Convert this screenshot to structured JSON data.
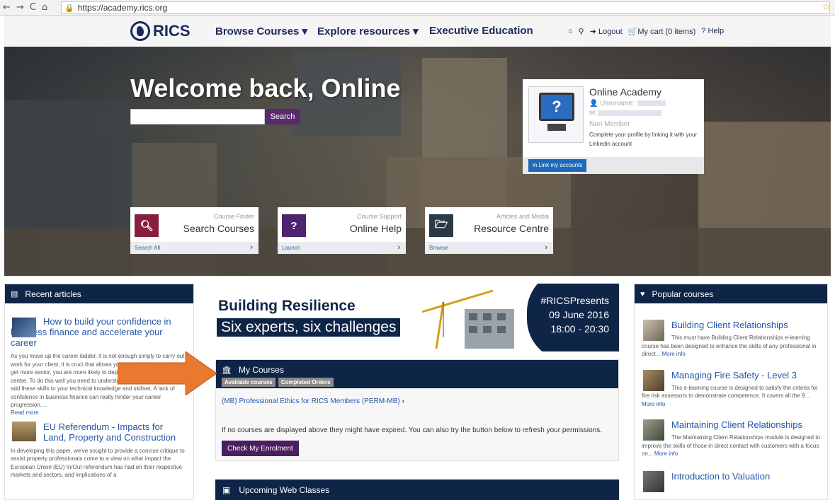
{
  "browser": {
    "url": "https://academy.rics.org"
  },
  "header": {
    "logo": "RICS",
    "menu": [
      "Browse Courses",
      "Explore resources",
      "Executive Education"
    ],
    "logout": "Logout",
    "cart": "My cart (0 items)",
    "help": "Help"
  },
  "hero": {
    "welcome": "Welcome back, Online",
    "search_button": "Search"
  },
  "profile": {
    "name": "Online Academy",
    "username_label": "Username:",
    "membership": "Non Member",
    "description": "Complete your profile by linking it with your Linkedin account",
    "link_button": "Link my accounts"
  },
  "quick_links": [
    {
      "small": "Course Finder",
      "big": "Search Courses",
      "action": "Search All",
      "color": "#8a1f3d",
      "icon": "search-icon"
    },
    {
      "small": "Course Support",
      "big": "Online Help",
      "action": "Launch",
      "color": "#4e2470",
      "icon": "question-icon"
    },
    {
      "small": "Articles and Media",
      "big": "Resource Centre",
      "action": "Browse",
      "color": "#2b3a44",
      "icon": "folder-icon"
    }
  ],
  "recent_articles": {
    "heading": "Recent articles",
    "items": [
      {
        "title": "How to build your confidence in business finance and accelerate your career",
        "body": "As you move up the career ladder, it is not enough simply to carry out work for your client; it is cruci that allows your organisation to make get more senior, you are more likely to department, office or cost centre. To do this well you need to understand business finance, and add these skills to your technical knowledge and skillset. A lack of confidence in business finance can really hinder your career progression....",
        "more": "Read more"
      },
      {
        "title": "EU Referendum - Impacts for Land, Property and Construction",
        "body": "In developing this paper, we've sought to provide a concise critique to assist property professionals come to a view on what impact the European Union (EU) In/Out referendum has had on their respective markets and sectors, and implications of a"
      }
    ]
  },
  "banner": {
    "title": "Building Resilience",
    "subtitle": "Six experts, six challenges",
    "tag": "#RICSPresents",
    "date": "09 June 2016",
    "time": "18:00 - 20:30"
  },
  "my_courses": {
    "heading": "My Courses",
    "tabs": [
      "Available courses",
      "Completed Orders"
    ],
    "course": "(MB) Professional Ethics for RICS Members (PERM-MB)",
    "note": "If no courses are displayed above they might have expired. You can also try the button below to refresh your permissions.",
    "button": "Check My Enrolment"
  },
  "web_classes": {
    "heading": "Upcoming Web Classes"
  },
  "popular_courses": {
    "heading": "Popular courses",
    "items": [
      {
        "title": "Building Client Relationships",
        "body": "This must have Building Client Relationships e-learning course has been designed to enhance the skills of any professional in direct...",
        "more": "More info"
      },
      {
        "title": "Managing Fire Safety - Level 3",
        "body": "This e-learning course is designed to satisfy the criteria for fire risk assessors to demonstrate competence. It covers all the 9...",
        "more": "More info"
      },
      {
        "title": "Maintaining Client Relationships",
        "body": "The Maintaining Client Relationships module is designed to improve the skills of those in direct contact with customers with a focus on...",
        "more": "More info"
      },
      {
        "title": "Introduction to Valuation"
      }
    ]
  },
  "colors": {
    "navy": "#0f2548",
    "purple": "#4a1f5e",
    "link": "#2356a8",
    "arrow": "#e8792e"
  }
}
